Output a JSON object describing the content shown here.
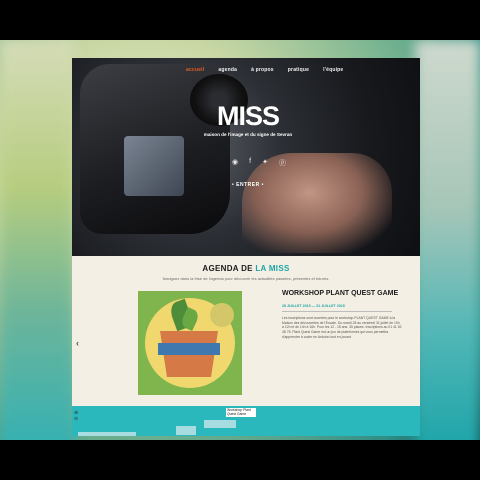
{
  "nav": {
    "items": [
      {
        "label": "accueil",
        "active": true
      },
      {
        "label": "agenda",
        "active": false
      },
      {
        "label": "à propos",
        "active": false
      },
      {
        "label": "pratique",
        "active": false
      },
      {
        "label": "l'équipe",
        "active": false
      }
    ]
  },
  "hero": {
    "logo_word": "MISS",
    "logo_subtitle": "maison de l'image et du signe de Sevran",
    "social_icons": [
      "rss-icon",
      "facebook-icon",
      "twitter-icon",
      "pinterest-icon"
    ],
    "enter_label": "• ENTRER •"
  },
  "agenda": {
    "title_prefix": "AGENDA DE ",
    "title_accent": "LA MISS",
    "subtitle": "Naviguez dans la frise de l'agenda pour découvrir les actualités passées, présentes et futures."
  },
  "event": {
    "title": "WORKSHOP PLANT QUEST GAME",
    "date": "28 JUILLET 2015 — 31 JUILLET 2015",
    "body": "Les inscriptions sont ouvertes pour le workshop PLANT QUEST GAME à la Maison des découvertes de l'Escale. Du mardi 28 au vendredi 31 juillet de 10h à 12h et de 14h à 16h. Pour les 12 - 15 ans. 35 places. Inscriptions au 01 41 52 48 75. Plant Quest Game est un jeu de plateformes qui vous permettra d'apprendre à coder en Arduino tout en jouant."
  },
  "timeline": {
    "tag_label": "Workshop Plant Quest Game"
  },
  "colors": {
    "accent_orange": "#e85d2a",
    "accent_teal": "#1aa6a6",
    "timeline_teal": "#2bb8bd"
  }
}
